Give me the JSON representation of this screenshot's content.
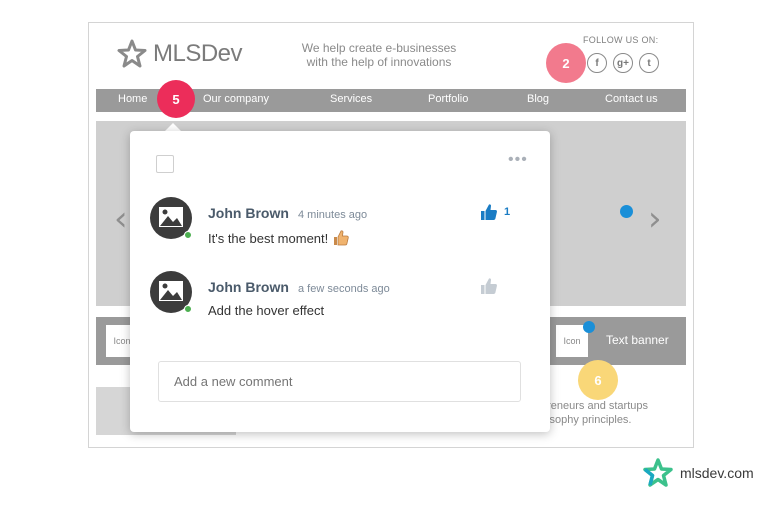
{
  "header": {
    "logo_text": "MLSDev",
    "tagline_line1": "We help create e-businesses",
    "tagline_line2": "with the help of innovations",
    "follow_label": "FOLLOW US ON:",
    "social": [
      "f",
      "g+",
      "t"
    ]
  },
  "nav": {
    "items": [
      "Home",
      "Our company",
      "Services",
      "Portfolio",
      "Blog",
      "Contact us"
    ]
  },
  "badges": {
    "b2": "2",
    "b5": "5",
    "b6": "6"
  },
  "banner": {
    "icon_left": "Icon",
    "icon_right": "Icon",
    "text": "Text banner"
  },
  "lower": {
    "line1": "preneurs and startups",
    "line2": "losophy principles."
  },
  "popup": {
    "more_label": "•••",
    "comments": [
      {
        "author": "John Brown",
        "time": "4 minutes ago",
        "text": "It's the best moment!",
        "likes": "1",
        "liked": true
      },
      {
        "author": "John Brown",
        "time": "a few seconds ago",
        "text": "Add the hover effect",
        "likes": "",
        "liked": false
      }
    ],
    "input_placeholder": "Add a new comment"
  },
  "brand": {
    "text": "mlsdev.com"
  },
  "colors": {
    "accent": "#1a8fd8",
    "badge_pink": "#ec2d5a",
    "badge_light_pink": "#f27a8d",
    "badge_yellow": "#f9d778",
    "brand_green": "#3cc18c",
    "brand_teal": "#1aa8c2"
  }
}
